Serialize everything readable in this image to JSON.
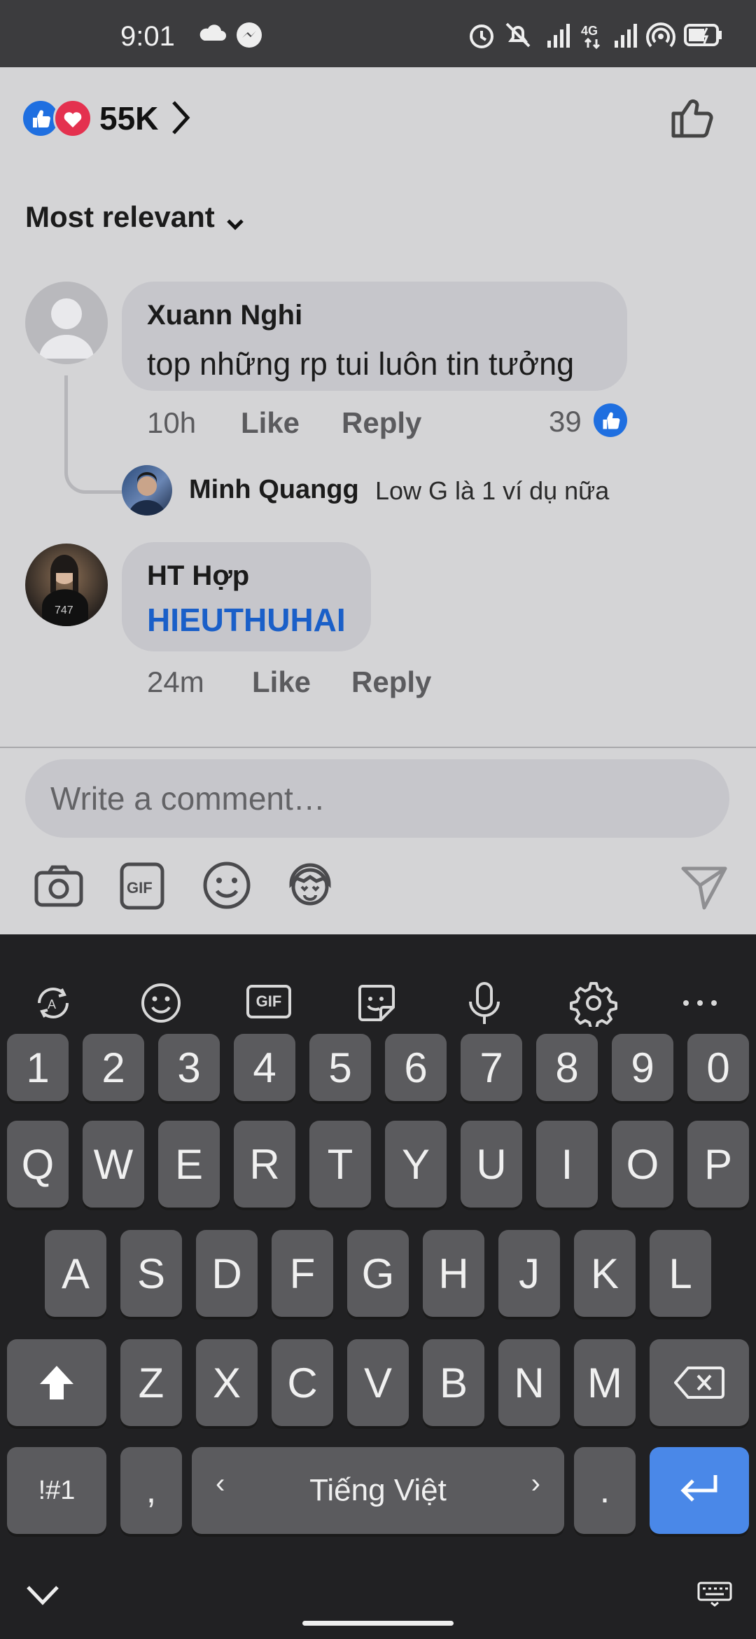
{
  "status_bar": {
    "time": "9:01"
  },
  "reactions": {
    "count": "55K"
  },
  "sort": {
    "label": "Most relevant"
  },
  "comments": [
    {
      "author": "Xuann Nghi",
      "text": "top những rp tui luôn tin tưởng",
      "time": "10h",
      "like_label": "Like",
      "reply_label": "Reply",
      "likes": "39",
      "reply_preview": {
        "author": "Minh Quangg",
        "text": "Low G là 1 ví dụ nữa"
      }
    },
    {
      "author": "HT Hợp",
      "text": "HIEUTHUHAI",
      "time": "24m",
      "like_label": "Like",
      "reply_label": "Reply"
    }
  ],
  "composer": {
    "placeholder": "Write a comment…"
  },
  "keyboard": {
    "row_numbers": [
      "1",
      "2",
      "3",
      "4",
      "5",
      "6",
      "7",
      "8",
      "9",
      "0"
    ],
    "row_q": [
      "Q",
      "W",
      "E",
      "R",
      "T",
      "Y",
      "U",
      "I",
      "O",
      "P"
    ],
    "row_a": [
      "A",
      "S",
      "D",
      "F",
      "G",
      "H",
      "J",
      "K",
      "L"
    ],
    "row_z": [
      "Z",
      "X",
      "C",
      "V",
      "B",
      "N",
      "M"
    ],
    "symbols_label": "!#1",
    "comma": ",",
    "space_label": "Tiếng Việt",
    "period": ".",
    "gif_label": "GIF"
  },
  "colors": {
    "accent": "#1a5fc8",
    "enter_key": "#4a88e8",
    "keyboard_bg": "#212123"
  }
}
